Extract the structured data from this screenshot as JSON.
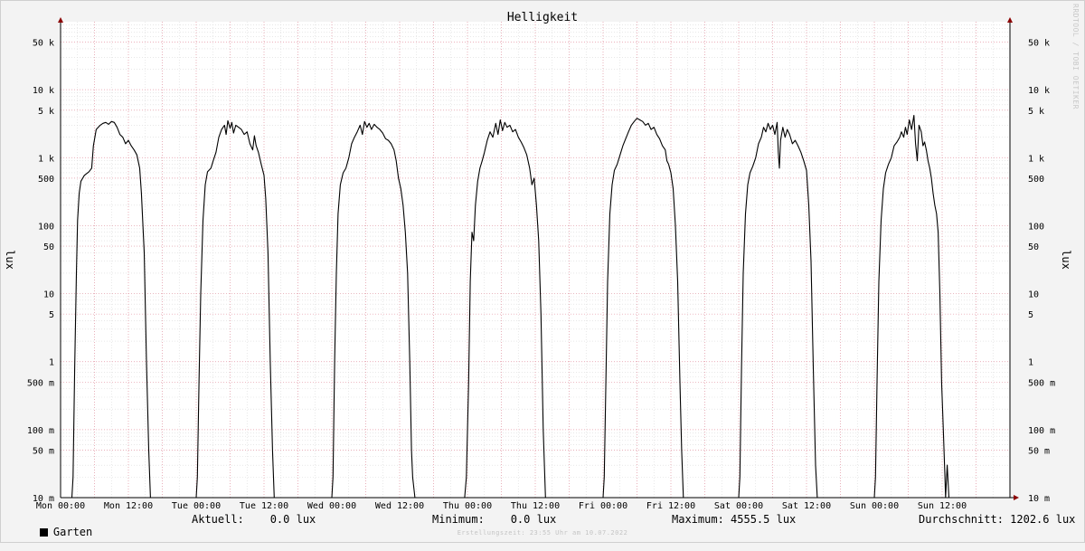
{
  "chart_data": {
    "type": "line",
    "title": "Helligkeit",
    "ylabel": "lux",
    "yscale": "log",
    "ylim": [
      0.01,
      100000
    ],
    "y_ticks": [
      {
        "value": 50000,
        "label": "50 k"
      },
      {
        "value": 10000,
        "label": "10 k"
      },
      {
        "value": 5000,
        "label": "5 k"
      },
      {
        "value": 1000,
        "label": "1 k"
      },
      {
        "value": 500,
        "label": "500"
      },
      {
        "value": 100,
        "label": "100"
      },
      {
        "value": 50,
        "label": "50"
      },
      {
        "value": 10,
        "label": "10"
      },
      {
        "value": 5,
        "label": "5"
      },
      {
        "value": 1,
        "label": "1"
      },
      {
        "value": 0.5,
        "label": "500 m"
      },
      {
        "value": 0.1,
        "label": "100 m"
      },
      {
        "value": 0.05,
        "label": "50 m"
      },
      {
        "value": 0.01,
        "label": "10 m"
      }
    ],
    "x_ticks": [
      "Mon 00:00",
      "Mon 12:00",
      "Tue 00:00",
      "Tue 12:00",
      "Wed 00:00",
      "Wed 12:00",
      "Thu 00:00",
      "Thu 12:00",
      "Fri 00:00",
      "Fri 12:00",
      "Sat 00:00",
      "Sat 12:00",
      "Sun 00:00",
      "Sun 12:00"
    ],
    "x_unit": "hours since Mon 00:00",
    "x_range": [
      0,
      168
    ],
    "grid": true,
    "legend": "bottom-left",
    "series": [
      {
        "name": "Garten",
        "color": "#000000",
        "points": [
          [
            0,
            0.01
          ],
          [
            2,
            0.01
          ],
          [
            2.2,
            0.02
          ],
          [
            2.5,
            0.8
          ],
          [
            2.8,
            20
          ],
          [
            3,
            120
          ],
          [
            3.3,
            300
          ],
          [
            3.6,
            450
          ],
          [
            4.2,
            550
          ],
          [
            5,
            620
          ],
          [
            5.5,
            700
          ],
          [
            5.8,
            1500
          ],
          [
            6.3,
            2600
          ],
          [
            7,
            3000
          ],
          [
            7.5,
            3200
          ],
          [
            8,
            3300
          ],
          [
            8.5,
            3100
          ],
          [
            9,
            3400
          ],
          [
            9.5,
            3300
          ],
          [
            10,
            2800
          ],
          [
            10.5,
            2200
          ],
          [
            11,
            2000
          ],
          [
            11.5,
            1600
          ],
          [
            12,
            1800
          ],
          [
            12.5,
            1500
          ],
          [
            13,
            1300
          ],
          [
            13.5,
            1100
          ],
          [
            14,
            700
          ],
          [
            14.3,
            300
          ],
          [
            14.8,
            40
          ],
          [
            15.2,
            1
          ],
          [
            15.6,
            0.05
          ],
          [
            15.9,
            0.01
          ],
          [
            24,
            0.01
          ],
          [
            24.2,
            0.02
          ],
          [
            24.5,
            0.5
          ],
          [
            24.8,
            10
          ],
          [
            25.2,
            120
          ],
          [
            25.6,
            400
          ],
          [
            26,
            620
          ],
          [
            26.6,
            700
          ],
          [
            27,
            900
          ],
          [
            27.5,
            1200
          ],
          [
            28,
            2000
          ],
          [
            28.5,
            2600
          ],
          [
            29,
            3000
          ],
          [
            29.3,
            2200
          ],
          [
            29.6,
            3500
          ],
          [
            30,
            2700
          ],
          [
            30.3,
            3300
          ],
          [
            30.6,
            2300
          ],
          [
            31,
            3000
          ],
          [
            31.5,
            2800
          ],
          [
            32,
            2600
          ],
          [
            32.5,
            2200
          ],
          [
            33,
            2400
          ],
          [
            33.5,
            1600
          ],
          [
            34,
            1300
          ],
          [
            34.3,
            2100
          ],
          [
            34.6,
            1500
          ],
          [
            35,
            1200
          ],
          [
            35.5,
            800
          ],
          [
            36,
            550
          ],
          [
            36.3,
            250
          ],
          [
            36.7,
            40
          ],
          [
            37.1,
            1
          ],
          [
            37.5,
            0.05
          ],
          [
            37.8,
            0.01
          ],
          [
            48,
            0.01
          ],
          [
            48.2,
            0.02
          ],
          [
            48.5,
            1
          ],
          [
            48.8,
            20
          ],
          [
            49.1,
            150
          ],
          [
            49.5,
            400
          ],
          [
            50,
            600
          ],
          [
            50.5,
            700
          ],
          [
            51,
            1000
          ],
          [
            51.5,
            1600
          ],
          [
            52,
            2000
          ],
          [
            52.5,
            2400
          ],
          [
            53,
            3000
          ],
          [
            53.4,
            2200
          ],
          [
            53.8,
            3400
          ],
          [
            54.2,
            2800
          ],
          [
            54.6,
            3200
          ],
          [
            55,
            2600
          ],
          [
            55.5,
            3100
          ],
          [
            56,
            2800
          ],
          [
            56.5,
            2600
          ],
          [
            57,
            2300
          ],
          [
            57.5,
            1900
          ],
          [
            58,
            1800
          ],
          [
            58.5,
            1600
          ],
          [
            59,
            1300
          ],
          [
            59.4,
            900
          ],
          [
            59.8,
            500
          ],
          [
            60.2,
            350
          ],
          [
            60.6,
            200
          ],
          [
            61,
            80
          ],
          [
            61.4,
            20
          ],
          [
            61.8,
            1
          ],
          [
            62.1,
            0.05
          ],
          [
            62.3,
            0.02
          ],
          [
            62.7,
            0.01
          ],
          [
            71.5,
            0.01
          ],
          [
            71.8,
            0.02
          ],
          [
            72.2,
            0.5
          ],
          [
            72.5,
            15
          ],
          [
            72.8,
            80
          ],
          [
            73.1,
            60
          ],
          [
            73.4,
            200
          ],
          [
            73.8,
            450
          ],
          [
            74.2,
            700
          ],
          [
            74.6,
            900
          ],
          [
            75,
            1200
          ],
          [
            75.5,
            1800
          ],
          [
            76,
            2400
          ],
          [
            76.5,
            2000
          ],
          [
            77,
            3200
          ],
          [
            77.4,
            2200
          ],
          [
            77.8,
            3600
          ],
          [
            78.2,
            2500
          ],
          [
            78.6,
            3300
          ],
          [
            79,
            2800
          ],
          [
            79.5,
            3000
          ],
          [
            80,
            2400
          ],
          [
            80.5,
            2600
          ],
          [
            81,
            2000
          ],
          [
            81.5,
            1700
          ],
          [
            82,
            1400
          ],
          [
            82.5,
            1100
          ],
          [
            83,
            700
          ],
          [
            83.4,
            400
          ],
          [
            83.8,
            500
          ],
          [
            84.2,
            200
          ],
          [
            84.6,
            60
          ],
          [
            85,
            5
          ],
          [
            85.4,
            0.1
          ],
          [
            85.8,
            0.01
          ],
          [
            96,
            0.01
          ],
          [
            96.2,
            0.02
          ],
          [
            96.5,
            0.5
          ],
          [
            96.8,
            15
          ],
          [
            97.2,
            150
          ],
          [
            97.6,
            400
          ],
          [
            98,
            650
          ],
          [
            98.5,
            800
          ],
          [
            99,
            1100
          ],
          [
            99.5,
            1500
          ],
          [
            100,
            1900
          ],
          [
            100.5,
            2400
          ],
          [
            101,
            3000
          ],
          [
            101.5,
            3400
          ],
          [
            102,
            3800
          ],
          [
            102.5,
            3600
          ],
          [
            103,
            3400
          ],
          [
            103.5,
            3000
          ],
          [
            104,
            3200
          ],
          [
            104.5,
            2600
          ],
          [
            105,
            2800
          ],
          [
            105.5,
            2200
          ],
          [
            106,
            1900
          ],
          [
            106.5,
            1500
          ],
          [
            107,
            1300
          ],
          [
            107.3,
            900
          ],
          [
            107.6,
            800
          ],
          [
            108,
            600
          ],
          [
            108.4,
            350
          ],
          [
            108.8,
            100
          ],
          [
            109.2,
            15
          ],
          [
            109.6,
            0.5
          ],
          [
            109.9,
            0.05
          ],
          [
            110.2,
            0.01
          ],
          [
            120,
            0.01
          ],
          [
            120.2,
            0.02
          ],
          [
            120.5,
            0.8
          ],
          [
            120.8,
            20
          ],
          [
            121.2,
            150
          ],
          [
            121.6,
            400
          ],
          [
            122,
            600
          ],
          [
            122.5,
            750
          ],
          [
            123,
            1000
          ],
          [
            123.5,
            1600
          ],
          [
            124,
            2000
          ],
          [
            124.4,
            2800
          ],
          [
            124.8,
            2400
          ],
          [
            125.2,
            3200
          ],
          [
            125.6,
            2600
          ],
          [
            126,
            3000
          ],
          [
            126.4,
            2200
          ],
          [
            126.8,
            3300
          ],
          [
            127,
            1200
          ],
          [
            127.2,
            700
          ],
          [
            127.4,
            1800
          ],
          [
            127.8,
            2800
          ],
          [
            128.2,
            2000
          ],
          [
            128.6,
            2600
          ],
          [
            129,
            2200
          ],
          [
            129.5,
            1600
          ],
          [
            130,
            1800
          ],
          [
            130.5,
            1500
          ],
          [
            131,
            1200
          ],
          [
            131.5,
            900
          ],
          [
            132,
            650
          ],
          [
            132.4,
            200
          ],
          [
            132.8,
            30
          ],
          [
            133.2,
            0.8
          ],
          [
            133.6,
            0.03
          ],
          [
            133.9,
            0.01
          ],
          [
            144,
            0.01
          ],
          [
            144.2,
            0.02
          ],
          [
            144.5,
            0.6
          ],
          [
            144.8,
            15
          ],
          [
            145.2,
            120
          ],
          [
            145.6,
            350
          ],
          [
            146,
            600
          ],
          [
            146.5,
            800
          ],
          [
            147,
            1000
          ],
          [
            147.5,
            1500
          ],
          [
            148,
            1700
          ],
          [
            148.5,
            2000
          ],
          [
            148.8,
            2400
          ],
          [
            149.2,
            2000
          ],
          [
            149.5,
            2800
          ],
          [
            149.8,
            2200
          ],
          [
            150.2,
            3600
          ],
          [
            150.6,
            2600
          ],
          [
            151,
            4200
          ],
          [
            151.3,
            1600
          ],
          [
            151.6,
            900
          ],
          [
            151.9,
            3000
          ],
          [
            152.3,
            2400
          ],
          [
            152.6,
            1500
          ],
          [
            152.9,
            1700
          ],
          [
            153.2,
            1300
          ],
          [
            153.5,
            900
          ],
          [
            153.8,
            700
          ],
          [
            154.1,
            500
          ],
          [
            154.4,
            300
          ],
          [
            154.7,
            200
          ],
          [
            155,
            150
          ],
          [
            155.3,
            80
          ],
          [
            155.6,
            10
          ],
          [
            155.9,
            0.5
          ],
          [
            156.2,
            0.1
          ],
          [
            156.5,
            0.02
          ],
          [
            156.6,
            0.01
          ],
          [
            156.9,
            0.03
          ],
          [
            157.2,
            0.01
          ],
          [
            168,
            0.01
          ]
        ]
      }
    ]
  },
  "legend_stats": {
    "series_label": "Garten",
    "current": "Aktuell:    0.0 lux",
    "minimum": "Minimum:    0.0 lux",
    "maximum": "Maximum: 4555.5 lux",
    "average": "Durchschnitt: 1202.6 lux"
  },
  "footer": "Erstellungszeit: 23:55 Uhr am 10.07.2022",
  "watermark": "RRDTOOL / TOBI OETIKER",
  "colors": {
    "background": "#f3f3f3",
    "canvas": "#ffffff",
    "major_grid": "#e89aa8",
    "minor_grid": "#d9d9d9",
    "axis_arrow": "#8b0000",
    "line": "#000000"
  }
}
